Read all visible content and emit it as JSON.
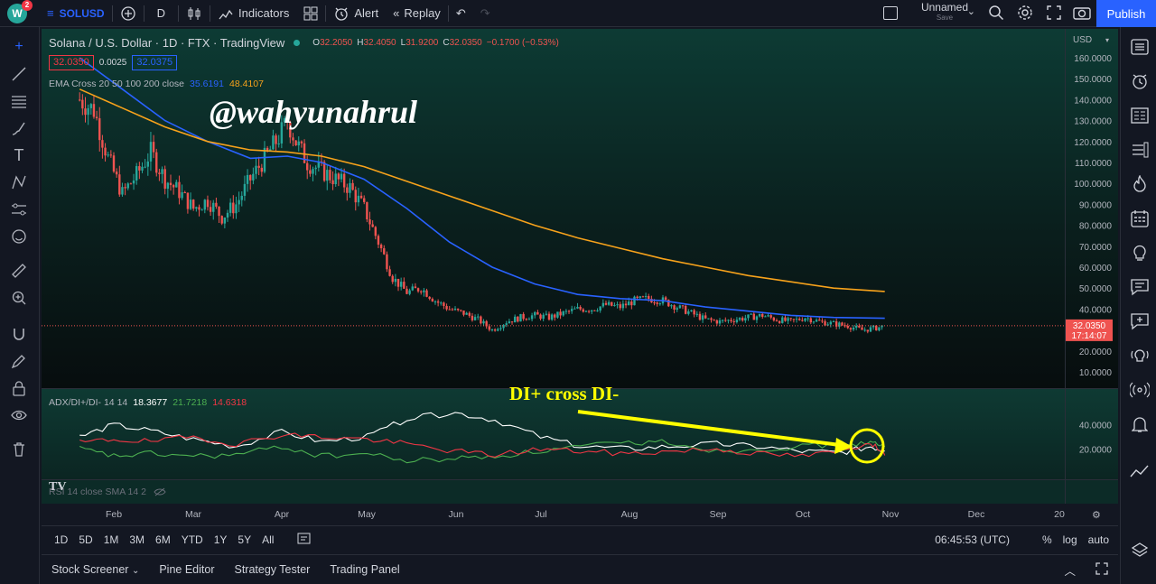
{
  "topbar": {
    "logo_letter": "W",
    "notifications": "2",
    "symbol": "SOLUSD",
    "interval": "D",
    "indicators_label": "Indicators",
    "alert_label": "Alert",
    "replay_label": "Replay",
    "layout_name": "Unnamed",
    "layout_status": "Save",
    "publish_label": "Publish"
  },
  "legend": {
    "title": "Solana / U.S. Dollar · 1D · FTX · TradingView",
    "open_label": "O",
    "open": "32.2050",
    "high_label": "H",
    "high": "32.4050",
    "low_label": "L",
    "low": "31.9200",
    "close_label": "C",
    "close": "32.0350",
    "change": "−0.1700 (−0.53%)",
    "bid": "32.0350",
    "spread": "0.0025",
    "ask": "32.0375",
    "ema_label": "EMA Cross 20 50 100 200 close",
    "ema_fast": "35.6191",
    "ema_slow": "48.4107",
    "adx_label": "ADX/DI+/DI- 14 14",
    "adx": "18.3677",
    "di_plus": "21.7218",
    "di_minus": "14.6318",
    "rsi_label": "RSI 14 close SMA 14 2"
  },
  "annotations": {
    "watermark": "@wahyunahrul",
    "callout": "DI+ cross DI-"
  },
  "price_axis": {
    "currency": "USD",
    "ticks": [
      "160.0000",
      "150.0000",
      "140.0000",
      "130.0000",
      "120.0000",
      "110.0000",
      "100.0000",
      "90.0000",
      "80.0000",
      "70.0000",
      "60.0000",
      "50.0000",
      "40.0000",
      "30.0000",
      "20.0000",
      "10.0000"
    ],
    "last_price": "32.0350",
    "countdown": "17:14:07"
  },
  "adx_axis": {
    "ticks": [
      "40.0000",
      "20.0000"
    ]
  },
  "time_axis": {
    "labels": [
      "Feb",
      "Mar",
      "Apr",
      "May",
      "Jun",
      "Jul",
      "Aug",
      "Sep",
      "Oct",
      "Nov",
      "Dec",
      "20"
    ]
  },
  "range_bar": {
    "ranges": [
      "1D",
      "5D",
      "1M",
      "3M",
      "6M",
      "YTD",
      "1Y",
      "5Y",
      "All"
    ],
    "clock": "06:45:53 (UTC)",
    "percent_label": "%",
    "log_label": "log",
    "auto_label": "auto"
  },
  "panel_tabs": [
    "Stock Screener",
    "Pine Editor",
    "Strategy Tester",
    "Trading Panel"
  ],
  "colors": {
    "up": "#26a69a",
    "down": "#ef5350",
    "ema_fast": "#2962ff",
    "ema_slow": "#f7a21b",
    "adx": "#ffffff",
    "di_plus": "#4caf50",
    "di_minus": "#f23645",
    "annotation": "#ffff00",
    "accent": "#2962ff"
  },
  "chart_data": {
    "type": "candlestick",
    "x": [
      "Jan 20",
      "Jan 25",
      "Jan 30",
      "Feb 4",
      "Feb 9",
      "Feb 14",
      "Feb 19",
      "Feb 24",
      "Mar 1",
      "Mar 6",
      "Mar 11",
      "Mar 16",
      "Mar 21",
      "Mar 26",
      "Mar 31",
      "Apr 3",
      "Apr 6",
      "Apr 10",
      "Apr 15",
      "Apr 20",
      "Apr 25",
      "Apr 30",
      "May 5",
      "May 10",
      "May 15",
      "May 20",
      "May 25",
      "May 30",
      "Jun 4",
      "Jun 9",
      "Jun 14",
      "Jun 19",
      "Jun 24",
      "Jun 29",
      "Jul 4",
      "Jul 9",
      "Jul 14",
      "Jul 19",
      "Jul 24",
      "Jul 29",
      "Aug 3",
      "Aug 8",
      "Aug 13",
      "Aug 18",
      "Aug 23",
      "Aug 28",
      "Sep 2",
      "Sep 7",
      "Sep 12",
      "Sep 17",
      "Sep 22",
      "Sep 27",
      "Oct 2",
      "Oct 7",
      "Oct 12",
      "Oct 17",
      "Oct 22",
      "Oct 27",
      "Oct 30"
    ],
    "close": [
      140,
      135,
      112,
      95,
      104,
      115,
      102,
      96,
      88,
      92,
      84,
      90,
      102,
      112,
      122,
      130,
      120,
      110,
      106,
      102,
      98,
      88,
      72,
      55,
      48,
      50,
      44,
      40,
      38,
      35,
      30,
      34,
      36,
      37,
      36,
      38,
      40,
      40,
      42,
      41,
      44,
      45,
      44,
      41,
      38,
      35,
      34,
      35,
      36,
      37,
      35,
      34,
      36,
      34,
      33,
      32,
      30,
      31,
      32
    ],
    "series": [
      {
        "name": "EMA fast",
        "x": [
          "Jan 20",
          "Feb 4",
          "Feb 19",
          "Mar 6",
          "Mar 21",
          "Apr 3",
          "Apr 15",
          "Apr 30",
          "May 15",
          "May 30",
          "Jun 14",
          "Jun 29",
          "Jul 14",
          "Jul 29",
          "Aug 13",
          "Aug 28",
          "Sep 12",
          "Sep 27",
          "Oct 12",
          "Oct 30"
        ],
        "values": [
          160,
          145,
          130,
          120,
          112,
          113,
          110,
          102,
          88,
          72,
          60,
          52,
          47,
          45,
          44,
          41,
          39,
          37,
          36,
          35.6191
        ]
      },
      {
        "name": "EMA slow",
        "x": [
          "Jan 20",
          "Feb 4",
          "Feb 19",
          "Mar 6",
          "Mar 21",
          "Apr 3",
          "Apr 15",
          "Apr 30",
          "May 15",
          "May 30",
          "Jun 14",
          "Jun 29",
          "Jul 14",
          "Jul 29",
          "Aug 13",
          "Aug 28",
          "Sep 12",
          "Sep 27",
          "Oct 12",
          "Oct 30"
        ],
        "values": [
          145,
          136,
          127,
          120,
          116,
          115,
          113,
          108,
          101,
          94,
          87,
          80,
          74,
          69,
          64,
          60,
          56,
          53,
          50,
          48.4107
        ]
      }
    ],
    "ylim": [
      10,
      160
    ],
    "adx_panel": {
      "ylim": [
        0,
        60
      ],
      "x": [
        "Jan 20",
        "Feb 1",
        "Feb 14",
        "Mar 1",
        "Mar 16",
        "Apr 1",
        "Apr 15",
        "May 1",
        "May 15",
        "Jun 1",
        "Jun 15",
        "Jul 1",
        "Jul 15",
        "Aug 1",
        "Aug 15",
        "Sep 1",
        "Sep 15",
        "Oct 1",
        "Oct 15",
        "Oct 25",
        "Oct 30"
      ],
      "adx": [
        30,
        40,
        35,
        28,
        22,
        34,
        26,
        30,
        45,
        50,
        44,
        30,
        22,
        20,
        22,
        24,
        22,
        18,
        17,
        22,
        18.3677
      ],
      "di_plus": [
        20,
        14,
        16,
        14,
        15,
        22,
        14,
        16,
        10,
        12,
        14,
        18,
        22,
        25,
        26,
        18,
        20,
        22,
        24,
        25,
        21.7218
      ],
      "di_minus": [
        25,
        28,
        26,
        30,
        24,
        32,
        30,
        28,
        24,
        18,
        15,
        20,
        18,
        16,
        18,
        20,
        16,
        14,
        18,
        26,
        14.6318
      ]
    }
  }
}
